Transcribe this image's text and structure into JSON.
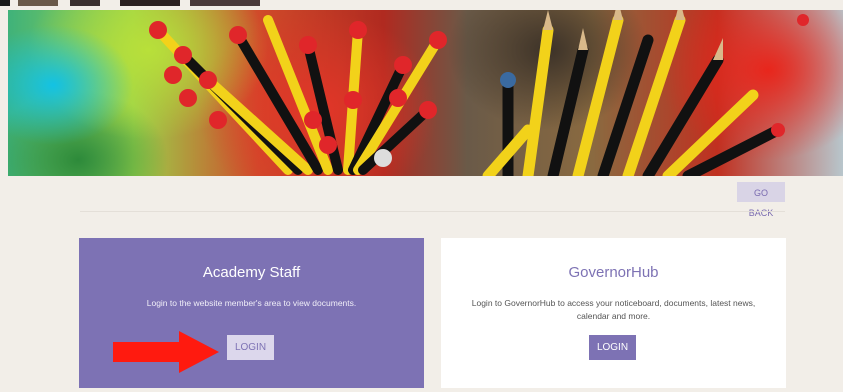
{
  "hero": {
    "image": "pencils-in-cups"
  },
  "nav": {
    "go_back_label": "GO BACK"
  },
  "cards": [
    {
      "title": "Academy Staff",
      "description": "Login to the website member's area to view documents.",
      "button_label": "LOGIN"
    },
    {
      "title": "GovernorHub",
      "description": "Login to GovernorHub to access your noticeboard, documents, latest news, calendar and more.",
      "button_label": "LOGIN"
    }
  ],
  "annotation": {
    "icon": "red-arrow-icon"
  },
  "colors": {
    "accent": "#7d72b4",
    "page_background": "#f2eee8",
    "arrow": "#ff1a0f"
  }
}
